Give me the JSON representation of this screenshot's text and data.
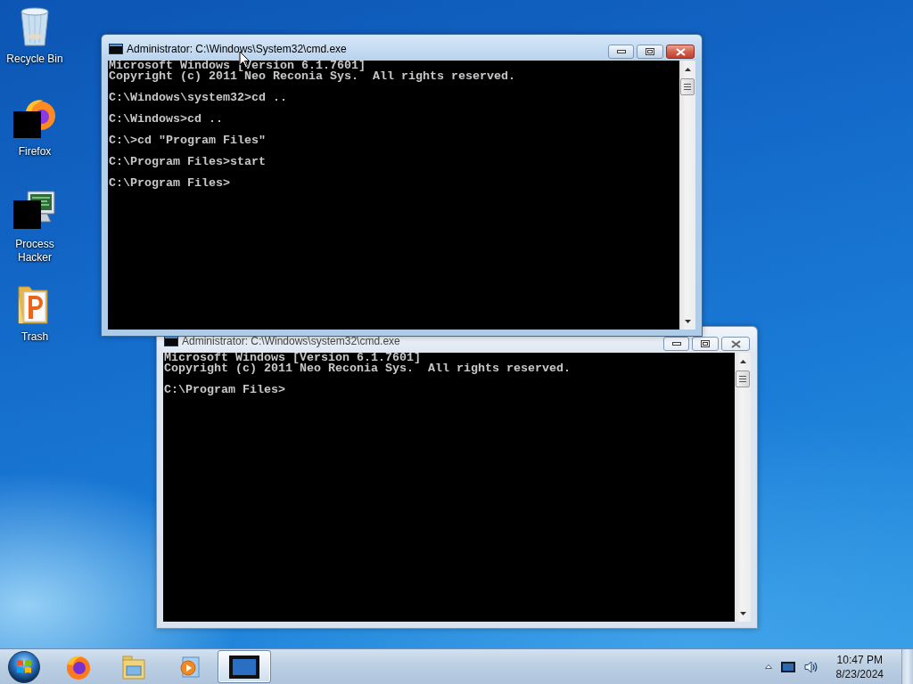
{
  "desktop_icons": [
    {
      "label": "Recycle Bin",
      "kind": "recycle"
    },
    {
      "label": "Firefox",
      "kind": "browser"
    },
    {
      "label": "Process Hacker",
      "kind": "monitor"
    },
    {
      "label": "Trash",
      "kind": "folder"
    }
  ],
  "windows": [
    {
      "title": "Administrator: C:\\Windows\\System32\\cmd.exe",
      "active": true,
      "console_blocks": [
        [
          "Microsoft Windows [Version 6.1.7601]",
          "Copyright (c) 2011 Neo Reconia Sys.  All rights reserved."
        ],
        [
          "C:\\Windows\\system32>cd .."
        ],
        [
          "C:\\Windows>cd .."
        ],
        [
          "C:\\>cd \"Program Files\""
        ],
        [
          "C:\\Program Files>start"
        ],
        [
          "C:\\Program Files>"
        ]
      ]
    },
    {
      "title": "Administrator: C:\\Windows\\system32\\cmd.exe",
      "active": false,
      "console_blocks": [
        [
          "Microsoft Windows [Version 6.1.7601]",
          "Copyright (c) 2011 Neo Reconia Sys.  All rights reserved."
        ],
        [
          "C:\\Program Files>"
        ]
      ]
    }
  ],
  "taskbar": {
    "items": [
      {
        "kind": "browser",
        "selected": false
      },
      {
        "kind": "folder",
        "selected": false
      },
      {
        "kind": "media",
        "selected": false
      },
      {
        "kind": "console",
        "selected": true
      }
    ],
    "clock": {
      "time": "10:47 PM",
      "date": "8/23/2024"
    }
  }
}
